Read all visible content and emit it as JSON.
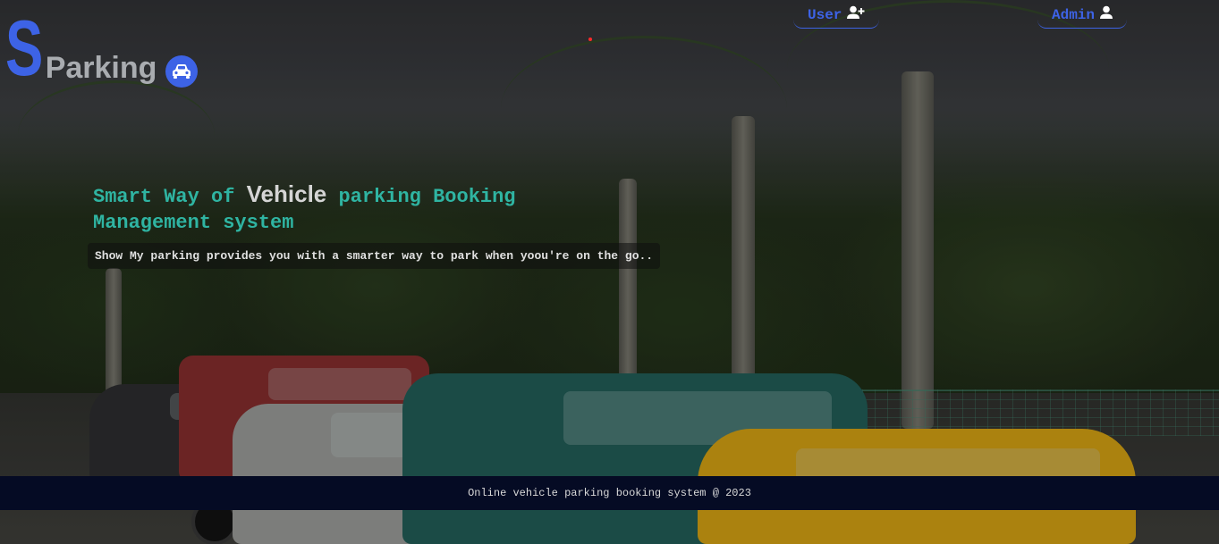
{
  "brand": {
    "letter": "S",
    "name": "Parking",
    "icon": "car-icon",
    "accent": "#3d63e6"
  },
  "nav": {
    "user": {
      "label": "User",
      "icon": "user-plus-icon"
    },
    "admin": {
      "label": "Admin",
      "icon": "user-icon"
    }
  },
  "hero": {
    "title_part1": "Smart Way of ",
    "title_strong": "Vehicle",
    "title_part2": " parking Booking Management system",
    "tagline": "Show My parking provides you with a smarter way to park when yoou're on the go.."
  },
  "footer": {
    "text": "Online vehicle parking booking system @ 2023"
  },
  "colors": {
    "heading": "#2fb4a2",
    "footer_bg": "#050b24"
  }
}
